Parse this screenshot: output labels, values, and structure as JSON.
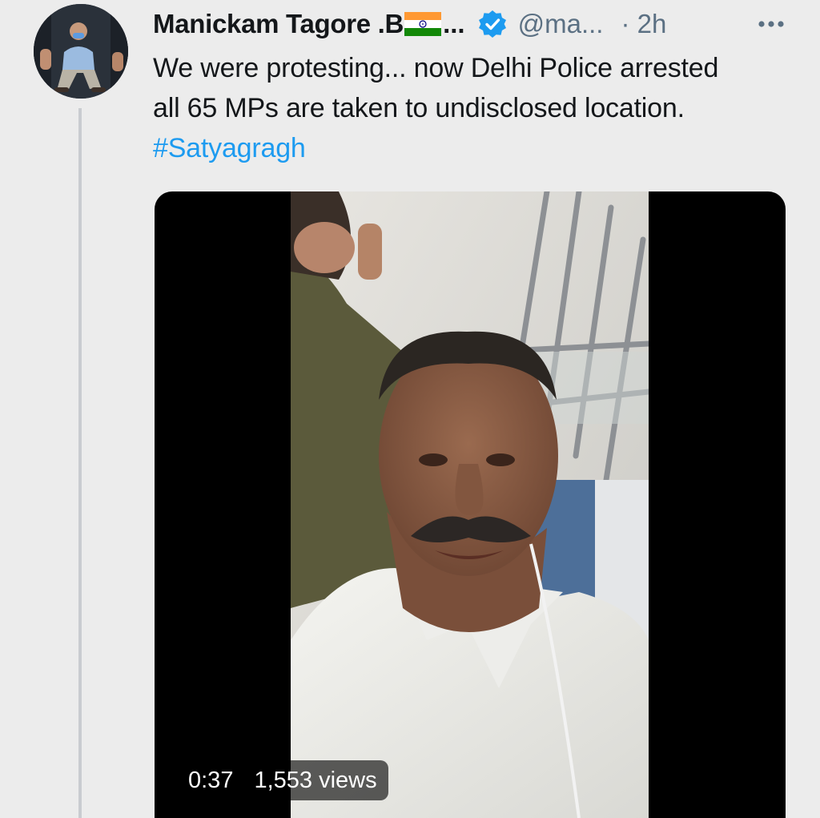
{
  "tweet": {
    "author_name": "Manickam Tagore .B",
    "name_truncation": "...",
    "verified_icon": "verified-badge-icon",
    "flag_icon": "india-flag-icon",
    "handle": "@ma...",
    "timestamp": "· 2h",
    "more_icon": "more-options-icon",
    "text_lines": [
      "We were protesting... now Delhi Police arrested",
      "all 65 MPs are taken to undisclosed location."
    ],
    "hashtag": "#Satyagragh",
    "media": {
      "type": "video",
      "duration": "0:37",
      "views": "1,553 views"
    }
  },
  "colors": {
    "background": "#ececec",
    "text": "#14171a",
    "secondary_text": "#5b7083",
    "link": "#1d9bf0",
    "verified": "#1d9bf0",
    "thread_line": "#c9ccd0"
  }
}
